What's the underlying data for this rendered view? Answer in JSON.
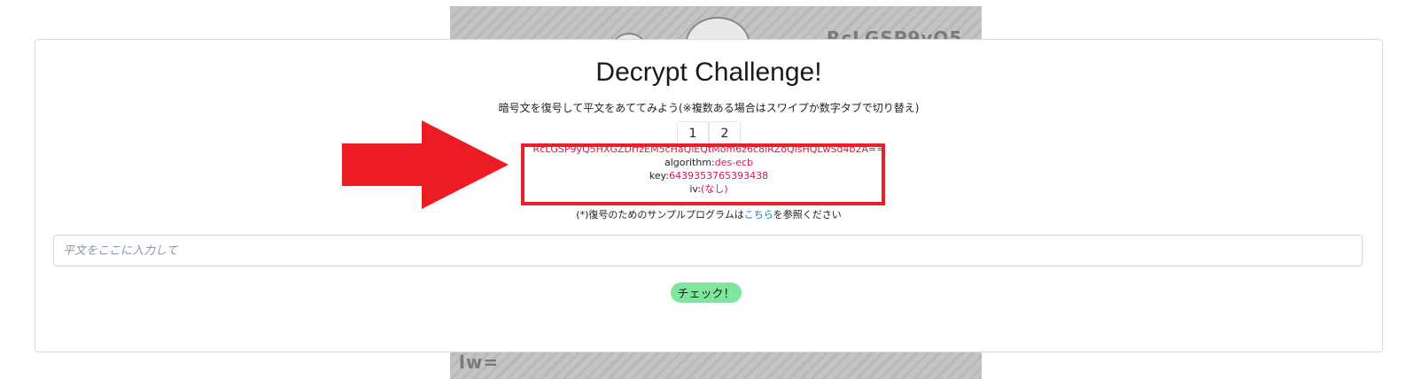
{
  "page": {
    "title": "Decrypt Challenge!",
    "subtitle": "暗号文を復号して平文をあててみよう(※複数ある場合はスワイプか数字タブで切り替え)"
  },
  "tabs": [
    {
      "label": "1"
    },
    {
      "label": "2"
    }
  ],
  "cipher": {
    "ciphertext": "RcLGSP9yQ5HXGZDrfzEM5cHaQlEQtMom6z6c8iRZoQlsHQLwSd4b2A==",
    "algorithm_label": "algorithm:",
    "algorithm_value": "des-ecb",
    "key_label": "key:",
    "key_value": "6439353765393438",
    "iv_label": "iv:",
    "iv_value": "(なし)"
  },
  "note": {
    "prefix": "(*)復号のためのサンプルプログラムは",
    "link": "こちら",
    "suffix": "を参照ください"
  },
  "input": {
    "placeholder": "平文をここに入力して",
    "value": ""
  },
  "check_button": "チェック！",
  "background": {
    "text_top": "RcLGSP9yQ5",
    "text_bottom": "lw="
  },
  "colors": {
    "highlight": "#e8202a",
    "arrow": "#ec1c24",
    "cipher_value": "#d8174d",
    "button": "#7fe69e"
  }
}
